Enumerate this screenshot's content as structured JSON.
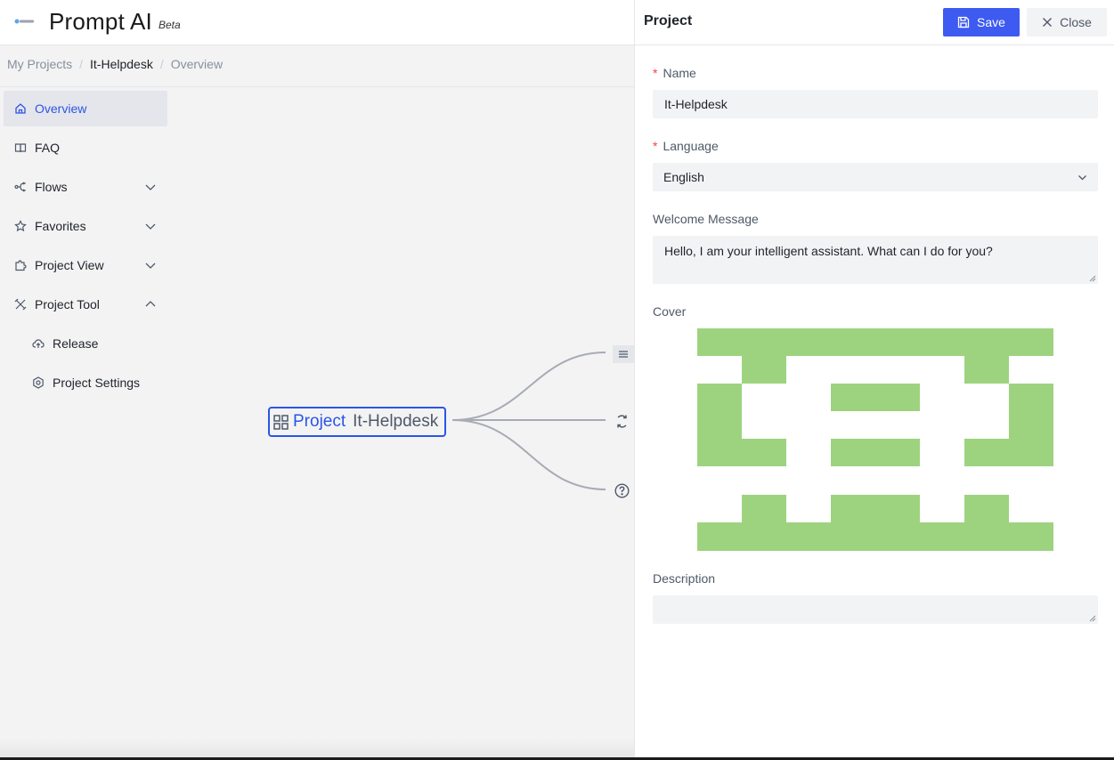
{
  "app": {
    "title": "Prompt AI",
    "badge": "Beta"
  },
  "breadcrumb": [
    "My Projects",
    "It-Helpdesk",
    "Overview"
  ],
  "sidebar": {
    "items": [
      {
        "label": "Overview",
        "icon": "home-icon",
        "selected": true
      },
      {
        "label": "FAQ",
        "icon": "book-icon"
      },
      {
        "label": "Flows",
        "icon": "flow-icon",
        "expand": "down"
      },
      {
        "label": "Favorites",
        "icon": "star-icon",
        "expand": "down"
      },
      {
        "label": "Project View",
        "icon": "puzzle-icon",
        "expand": "down"
      },
      {
        "label": "Project Tool",
        "icon": "tools-icon",
        "expand": "up"
      },
      {
        "label": "Release",
        "icon": "cloud-icon",
        "sub": true
      },
      {
        "label": "Project Settings",
        "icon": "settings-icon",
        "sub": true
      }
    ]
  },
  "canvas": {
    "root_label": "Project",
    "root_value": "It-Helpdesk",
    "branch_icons": [
      "menu-icon",
      "refresh-icon",
      "help-circle-icon"
    ]
  },
  "panel": {
    "title": "Project",
    "save_label": "Save",
    "close_label": "Close",
    "name_label": "Name",
    "name_value": "It-Helpdesk",
    "language_label": "Language",
    "language_value": "English",
    "welcome_label": "Welcome Message",
    "welcome_value": "Hello, I am your intelligent assistant. What can I do for you?",
    "cover_label": "Cover",
    "description_label": "Description",
    "description_value": ""
  },
  "colors": {
    "accent": "#2b55e6",
    "button": "#3d5af1",
    "cover": "#9dd37f",
    "required": "#f53f3f"
  }
}
